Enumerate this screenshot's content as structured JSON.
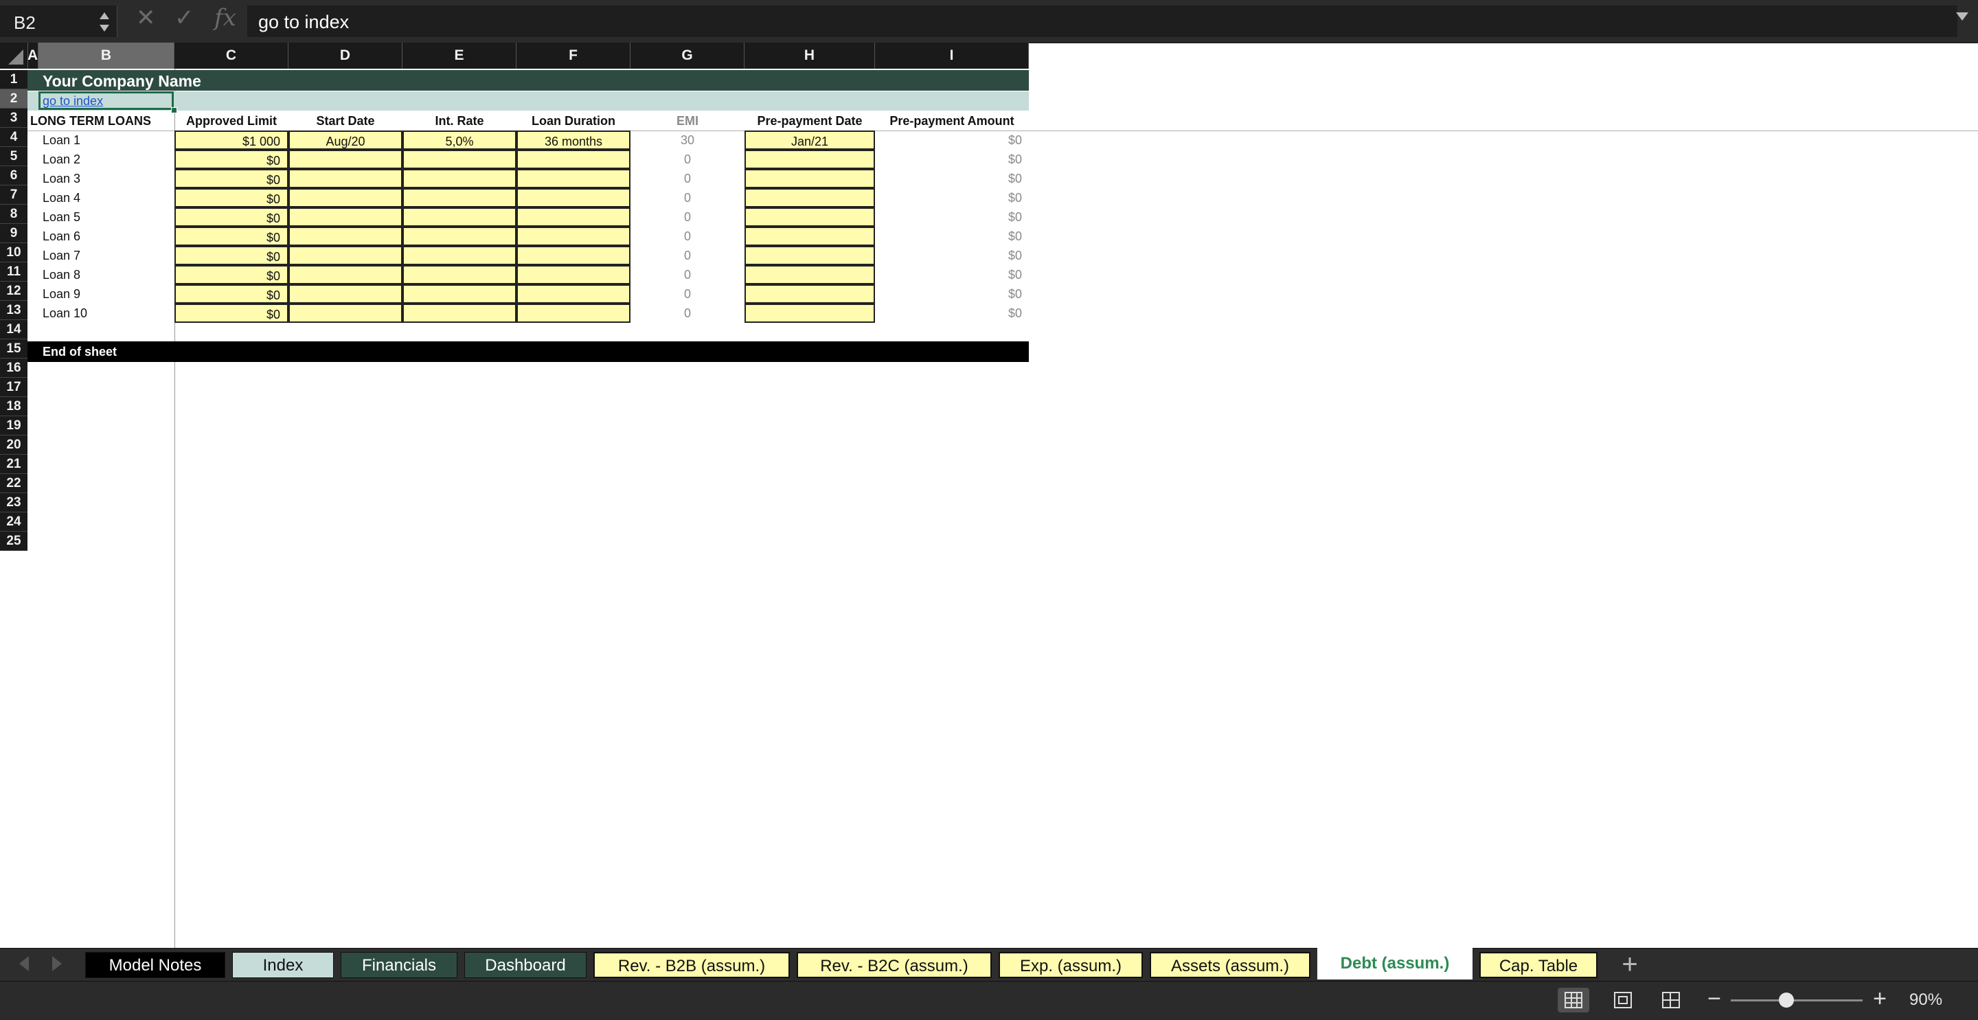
{
  "formula_bar": {
    "cell_ref": "B2",
    "cancel_icon": "✕",
    "confirm_icon": "✓",
    "fx_label": "fx",
    "content": "go to index"
  },
  "columns": [
    "A",
    "B",
    "C",
    "D",
    "E",
    "F",
    "G",
    "H",
    "I"
  ],
  "rows": [
    "1",
    "2",
    "3",
    "4",
    "5",
    "6",
    "7",
    "8",
    "9",
    "10",
    "11",
    "12",
    "13",
    "14",
    "15",
    "16",
    "17",
    "18",
    "19",
    "20",
    "21",
    "22",
    "23",
    "24",
    "25"
  ],
  "sheet": {
    "company_name": "Your Company Name",
    "index_link": "go to index",
    "section_title": "LONG TERM LOANS",
    "headers": {
      "approved_limit": "Approved Limit",
      "start_date": "Start Date",
      "int_rate": "Int. Rate",
      "loan_duration": "Loan Duration",
      "emi": "EMI",
      "prepayment_date": "Pre-payment Date",
      "prepayment_amount": "Pre-payment Amount"
    },
    "loans": [
      {
        "name": "Loan 1",
        "approved_limit": "$1 000",
        "start_date": "Aug/20",
        "int_rate": "5,0%",
        "duration": "36 months",
        "emi": "30",
        "prepayment_date": "Jan/21",
        "prepayment_amount": "$0"
      },
      {
        "name": "Loan 2",
        "approved_limit": "$0",
        "start_date": "",
        "int_rate": "",
        "duration": "",
        "emi": "0",
        "prepayment_date": "",
        "prepayment_amount": "$0"
      },
      {
        "name": "Loan 3",
        "approved_limit": "$0",
        "start_date": "",
        "int_rate": "",
        "duration": "",
        "emi": "0",
        "prepayment_date": "",
        "prepayment_amount": "$0"
      },
      {
        "name": "Loan 4",
        "approved_limit": "$0",
        "start_date": "",
        "int_rate": "",
        "duration": "",
        "emi": "0",
        "prepayment_date": "",
        "prepayment_amount": "$0"
      },
      {
        "name": "Loan 5",
        "approved_limit": "$0",
        "start_date": "",
        "int_rate": "",
        "duration": "",
        "emi": "0",
        "prepayment_date": "",
        "prepayment_amount": "$0"
      },
      {
        "name": "Loan 6",
        "approved_limit": "$0",
        "start_date": "",
        "int_rate": "",
        "duration": "",
        "emi": "0",
        "prepayment_date": "",
        "prepayment_amount": "$0"
      },
      {
        "name": "Loan 7",
        "approved_limit": "$0",
        "start_date": "",
        "int_rate": "",
        "duration": "",
        "emi": "0",
        "prepayment_date": "",
        "prepayment_amount": "$0"
      },
      {
        "name": "Loan 8",
        "approved_limit": "$0",
        "start_date": "",
        "int_rate": "",
        "duration": "",
        "emi": "0",
        "prepayment_date": "",
        "prepayment_amount": "$0"
      },
      {
        "name": "Loan 9",
        "approved_limit": "$0",
        "start_date": "",
        "int_rate": "",
        "duration": "",
        "emi": "0",
        "prepayment_date": "",
        "prepayment_amount": "$0"
      },
      {
        "name": "Loan 10",
        "approved_limit": "$0",
        "start_date": "",
        "int_rate": "",
        "duration": "",
        "emi": "0",
        "prepayment_date": "",
        "prepayment_amount": "$0"
      }
    ],
    "end_label": "End of sheet"
  },
  "tabs": [
    {
      "label": "Model Notes",
      "style": "black"
    },
    {
      "label": "Index",
      "style": "light"
    },
    {
      "label": "Financials",
      "style": "green"
    },
    {
      "label": "Dashboard",
      "style": "green"
    },
    {
      "label": "Rev. - B2B (assum.)",
      "style": "yellow"
    },
    {
      "label": "Rev. - B2C (assum.)",
      "style": "yellow"
    },
    {
      "label": "Exp. (assum.)",
      "style": "yellow"
    },
    {
      "label": "Assets (assum.)",
      "style": "yellow"
    },
    {
      "label": "Debt (assum.)",
      "style": "active"
    },
    {
      "label": "Cap. Table",
      "style": "yellow"
    }
  ],
  "add_sheet_label": "+",
  "status_bar": {
    "zoom_minus": "−",
    "zoom_plus": "+",
    "zoom_level": "90%",
    "zoom_percent": 90
  },
  "colors": {
    "title_band": "#2e4b42",
    "index_band": "#c6dcd8",
    "input_cell": "#fffbaf",
    "active_tab_text": "#2e8a55",
    "selection": "#1f6b4a"
  }
}
